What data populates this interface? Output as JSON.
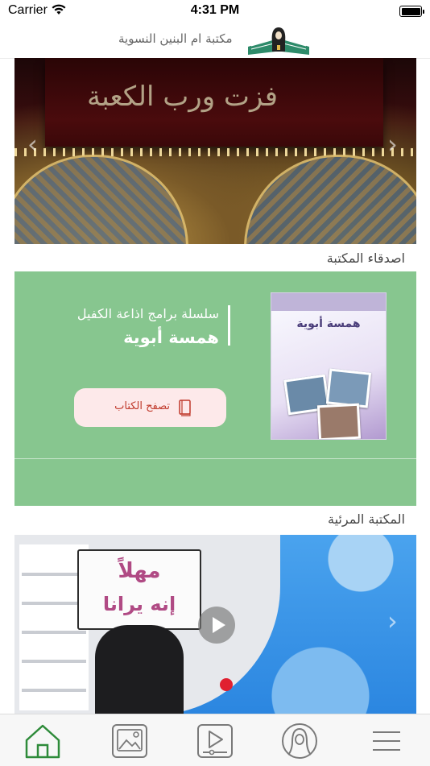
{
  "status_bar": {
    "carrier": "Carrier",
    "time": "4:31 PM"
  },
  "header": {
    "title": "مكتبة ام البنين النسوية",
    "logo_icon": "library-logo-icon"
  },
  "banner": {
    "calligraphy": "فزت ورب الكعبة"
  },
  "friends_section": {
    "label": "اصدقاء المكتبة",
    "series": "سلسلة برامج اذاعة الكفيل",
    "book_title": "همسة أبوية",
    "cover_title": "همسة أبوية",
    "browse_label": "تصفح الكتاب",
    "browse_icon": "book-icon"
  },
  "video_section": {
    "label": "المكتبة المرئية",
    "sign_line1": "مهلاً",
    "sign_line2": "إنه يرانا",
    "play_icon": "play-icon"
  },
  "tabs": [
    {
      "name": "home",
      "icon": "home-icon",
      "active": true
    },
    {
      "name": "gallery",
      "icon": "image-icon",
      "active": false
    },
    {
      "name": "videos",
      "icon": "video-icon",
      "active": false
    },
    {
      "name": "women",
      "icon": "woman-icon",
      "active": false
    },
    {
      "name": "menu",
      "icon": "menu-icon",
      "active": false
    }
  ],
  "colors": {
    "accent": "#2e8b3a",
    "card": "#87c68f",
    "button_bg": "#fde9ea",
    "button_text": "#c0392b"
  }
}
